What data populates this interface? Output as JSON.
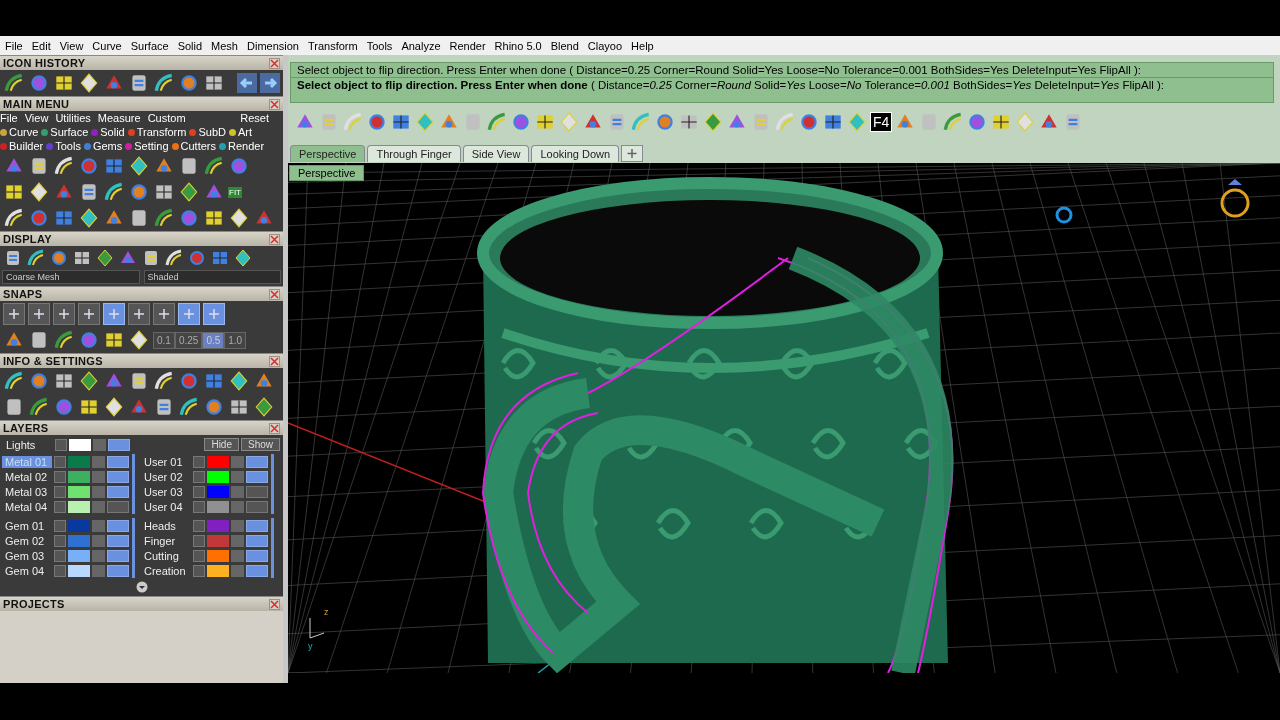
{
  "menu_bar": [
    "File",
    "Edit",
    "View",
    "Curve",
    "Surface",
    "Solid",
    "Mesh",
    "Dimension",
    "Transform",
    "Tools",
    "Analyze",
    "Render",
    "Rhino 5.0",
    "Blend",
    "Clayoo",
    "Help"
  ],
  "icon_history": {
    "title": "ICON HISTORY"
  },
  "main_menu": {
    "title": "MAIN MENU",
    "menu": [
      "File",
      "View",
      "Utilities",
      "Measure",
      "Custom"
    ],
    "reset": "Reset",
    "categories": [
      {
        "label": "Curve",
        "color": "#c8a838"
      },
      {
        "label": "Surface",
        "color": "#30a070"
      },
      {
        "label": "Solid",
        "color": "#9020c0"
      },
      {
        "label": "Transform",
        "color": "#e04020"
      },
      {
        "label": "SubD",
        "color": "#e04020"
      },
      {
        "label": "Art",
        "color": "#d0c030"
      },
      {
        "label": "Builder",
        "color": "#d02020"
      },
      {
        "label": "Tools",
        "color": "#6040d0"
      },
      {
        "label": "Gems",
        "color": "#4080d0"
      },
      {
        "label": "Setting",
        "color": "#d020a0"
      },
      {
        "label": "Cutters",
        "color": "#f07010"
      },
      {
        "label": "Render",
        "color": "#20a0b0"
      }
    ],
    "fit_label": "FIT"
  },
  "display": {
    "title": "DISPLAY",
    "mesh_dropdown": "Coarse Mesh",
    "shade_dropdown": "Shaded"
  },
  "snaps": {
    "title": "SNAPS",
    "toggles": [
      {
        "on": false
      },
      {
        "on": false
      },
      {
        "on": false
      },
      {
        "on": false
      },
      {
        "on": true
      },
      {
        "on": false
      },
      {
        "on": false
      },
      {
        "on": true
      },
      {
        "on": true
      }
    ],
    "grid_steps": [
      {
        "label": "0.1",
        "selected": false
      },
      {
        "label": "0.25",
        "selected": false
      },
      {
        "label": "0.5",
        "selected": true
      },
      {
        "label": "1.0",
        "selected": false
      }
    ]
  },
  "info_settings": {
    "title": "INFO & SETTINGS"
  },
  "layers": {
    "title": "LAYERS",
    "lights": {
      "label": "Lights",
      "color": "#ffffff",
      "on": true
    },
    "hide": "Hide",
    "show": "Show",
    "left_column": [
      {
        "name": "Metal 01",
        "color": "#0a7a4a",
        "selected": true,
        "on": true
      },
      {
        "name": "Metal 02",
        "color": "#3cb060",
        "selected": false,
        "on": true
      },
      {
        "name": "Metal 03",
        "color": "#70e070",
        "selected": false,
        "on": true
      },
      {
        "name": "Metal 04",
        "color": "#b8f0b0",
        "selected": false,
        "on": false
      },
      {
        "name": "Gem 01",
        "color": "#0838a0",
        "selected": false,
        "on": true
      },
      {
        "name": "Gem 02",
        "color": "#3070d0",
        "selected": false,
        "on": true
      },
      {
        "name": "Gem 03",
        "color": "#78b0f8",
        "selected": false,
        "on": true
      },
      {
        "name": "Gem 04",
        "color": "#b8d8ff",
        "selected": false,
        "on": true
      }
    ],
    "right_column": [
      {
        "name": "User 01",
        "color": "#ff0000",
        "selected": false,
        "on": true
      },
      {
        "name": "User 02",
        "color": "#00ff00",
        "selected": false,
        "on": true
      },
      {
        "name": "User 03",
        "color": "#0000ff",
        "selected": false,
        "on": false
      },
      {
        "name": "User 04",
        "color": "#909090",
        "selected": false,
        "on": false
      },
      {
        "name": "Heads",
        "color": "#8020c0",
        "selected": false,
        "on": true
      },
      {
        "name": "Finger",
        "color": "#c03838",
        "selected": false,
        "on": true
      },
      {
        "name": "Cutting",
        "color": "#ff7000",
        "selected": false,
        "on": true
      },
      {
        "name": "Creation",
        "color": "#ffb020",
        "selected": false,
        "on": true
      }
    ]
  },
  "projects": {
    "title": "PROJECTS"
  },
  "command": {
    "history": "Select object to flip direction. Press Enter when done ( Distance=0.25  Corner=Round  Solid=Yes  Loose=No  Tolerance=0.001  BothSides=Yes  DeleteInput=Yes  FlipAll ):",
    "prompt": "**Select object to flip direction. Press Enter when done** ( Distance=*0.25*  Corner=*Round*  Solid=*Yes*  Loose=*No*  Tolerance=*0.001*  BothSides=*Yes*  DeleteInput=*Yes*  FlipAll ):"
  },
  "toolbar": {
    "f4_label": "F4"
  },
  "viewport_tabs": [
    {
      "label": "Perspective",
      "selected": true
    },
    {
      "label": "Through Finger",
      "selected": false
    },
    {
      "label": "Side View",
      "selected": false
    },
    {
      "label": "Looking Down",
      "selected": false
    }
  ],
  "viewport": {
    "label": "Perspective",
    "axis_labels": [
      "z",
      "y"
    ]
  }
}
